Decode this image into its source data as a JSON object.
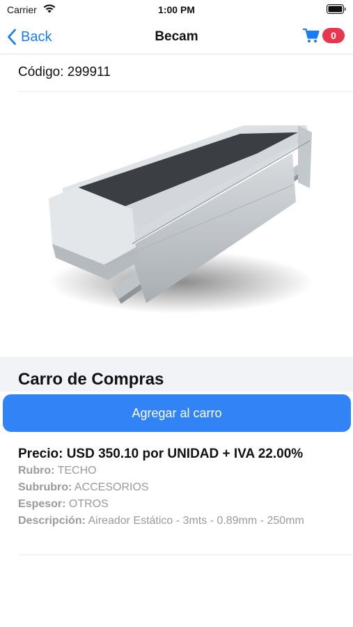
{
  "status_bar": {
    "carrier": "Carrier",
    "time": "1:00 PM"
  },
  "nav": {
    "back_label": "Back",
    "title": "Becam",
    "cart_count": "0"
  },
  "product": {
    "code_label": "Código: 299911",
    "image_icon": "ventilation-ridge-product-photo"
  },
  "cart_section": {
    "title": "Carro de Compras",
    "add_button_label": "Agregar al carro"
  },
  "details": {
    "price": "Precio: USD 350.10 por UNIDAD + IVA 22.00%",
    "rows": [
      {
        "key": "Rubro:",
        "value": "TECHO"
      },
      {
        "key": "Subrubro:",
        "value": "ACCESORIOS"
      },
      {
        "key": "Espesor:",
        "value": "OTROS"
      },
      {
        "key": "Descripción:",
        "value": "Aireador Estático - 3mts - 0.89mm - 250mm"
      }
    ]
  },
  "colors": {
    "accent": "#3283f5",
    "badge": "#e8364f",
    "section_bg": "#f2f3f7",
    "muted_text": "#9a9a9e"
  }
}
